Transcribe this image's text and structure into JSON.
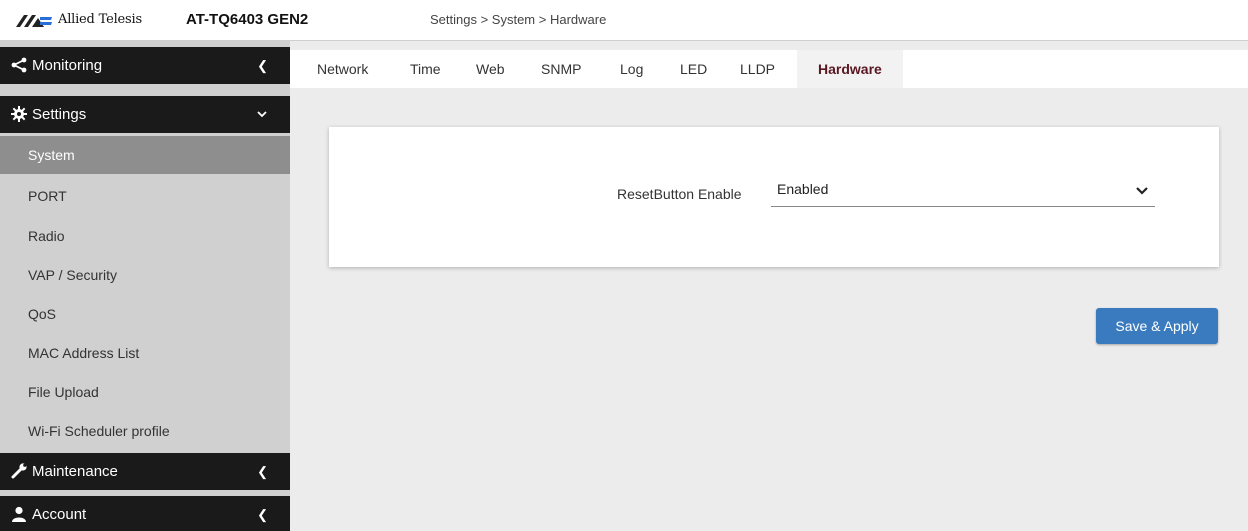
{
  "header": {
    "brand": "Allied Telesis",
    "model": "AT-TQ6403 GEN2",
    "breadcrumb": "Settings > System > Hardware"
  },
  "sidebar": {
    "groups": [
      {
        "label": "Monitoring",
        "icon": "share-icon",
        "expanded": false
      },
      {
        "label": "Settings",
        "icon": "gear-icon",
        "expanded": true,
        "items": [
          {
            "label": "System",
            "active": true
          },
          {
            "label": "PORT"
          },
          {
            "label": "Radio"
          },
          {
            "label": "VAP / Security"
          },
          {
            "label": "QoS"
          },
          {
            "label": "MAC Address List"
          },
          {
            "label": "File Upload"
          },
          {
            "label": "Wi-Fi Scheduler profile"
          }
        ]
      },
      {
        "label": "Maintenance",
        "icon": "wrench-icon",
        "expanded": false
      },
      {
        "label": "Account",
        "icon": "user-icon",
        "expanded": false
      }
    ]
  },
  "tabs": [
    {
      "label": "Network"
    },
    {
      "label": "Time"
    },
    {
      "label": "Web"
    },
    {
      "label": "SNMP"
    },
    {
      "label": "Log"
    },
    {
      "label": "LED"
    },
    {
      "label": "LLDP"
    },
    {
      "label": "Hardware",
      "active": true
    }
  ],
  "form": {
    "reset_label": "ResetButton Enable",
    "reset_value": "Enabled"
  },
  "actions": {
    "save_label": "Save & Apply"
  },
  "colors": {
    "sidebar_dark": "#1a1a1a",
    "sidebar_bg": "#d0d0d0",
    "sidebar_active": "#8e8e8e",
    "tab_active_text": "#5a1621",
    "button": "#3a7bbf"
  }
}
